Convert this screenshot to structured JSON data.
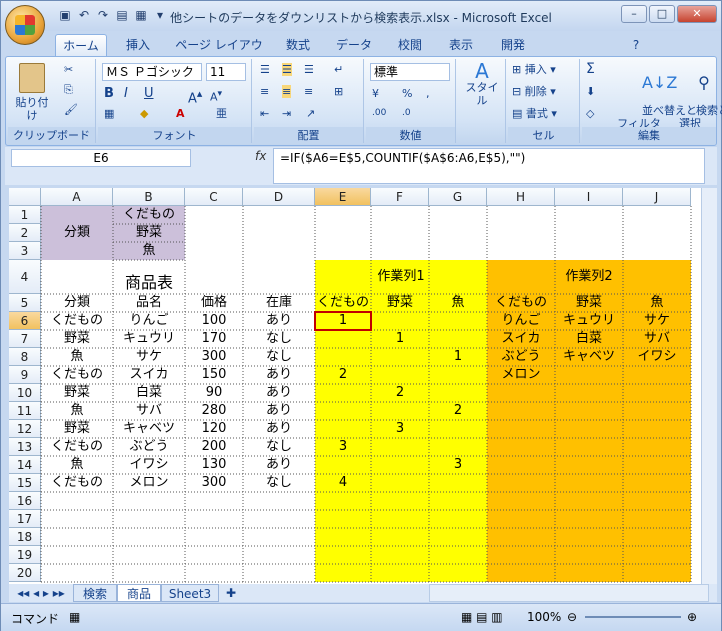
{
  "window": {
    "title": "他シートのデータをダウンリストから検索表示.xlsx - Microsoft Excel"
  },
  "ribbon_tabs": [
    "ホーム",
    "挿入",
    "ページ レイアウト",
    "数式",
    "データ",
    "校閲",
    "表示",
    "開発"
  ],
  "ribbon": {
    "paste": "貼り付け",
    "clipboard": "クリップボード",
    "font_name": "ＭＳ Ｐゴシック",
    "font_size": "11",
    "font_group": "フォント",
    "align_group": "配置",
    "number_format": "標準",
    "number_group": "数値",
    "style": "スタイル",
    "insert": "挿入",
    "delete": "削除",
    "format": "書式",
    "cell_group": "セル",
    "sort_filter": "並べ替えと\nフィルタ",
    "find_select": "検索と\n選択",
    "edit_group": "編集",
    "sigma": "Σ",
    "bold": "B",
    "italic": "I",
    "underline": "U"
  },
  "formula": {
    "name_box": "E6",
    "fx": "fx",
    "text": "=IF($A6=E$5,COUNTIF($A$6:A6,E$5),\"\")"
  },
  "columns": [
    "A",
    "B",
    "C",
    "D",
    "E",
    "F",
    "G",
    "H",
    "I",
    "J"
  ],
  "rows": [
    "1",
    "2",
    "3",
    "4",
    "5",
    "6",
    "7",
    "8",
    "9",
    "10",
    "11",
    "12",
    "13",
    "14",
    "15",
    "16",
    "17",
    "18",
    "19",
    "20"
  ],
  "cells": {
    "A1": "分類",
    "B1": "くだもの",
    "B2": "野菜",
    "B3": "魚",
    "B4": "商品表",
    "E4": "作業列1",
    "H4": "作業列2",
    "hdr": [
      "分類",
      "品名",
      "価格",
      "在庫",
      "くだもの",
      "野菜",
      "魚",
      "くだもの",
      "野菜",
      "魚"
    ],
    "data": [
      [
        "くだもの",
        "りんご",
        "100",
        "あり",
        "1",
        "",
        "",
        "りんご",
        "キュウリ",
        "サケ"
      ],
      [
        "野菜",
        "キュウリ",
        "170",
        "なし",
        "",
        "1",
        "",
        "スイカ",
        "白菜",
        "サバ"
      ],
      [
        "魚",
        "サケ",
        "300",
        "なし",
        "",
        "",
        "1",
        "ぶどう",
        "キャベツ",
        "イワシ"
      ],
      [
        "くだもの",
        "スイカ",
        "150",
        "あり",
        "2",
        "",
        "",
        "メロン",
        "",
        ""
      ],
      [
        "野菜",
        "白菜",
        "90",
        "あり",
        "",
        "2",
        "",
        "",
        "",
        ""
      ],
      [
        "魚",
        "サバ",
        "280",
        "あり",
        "",
        "",
        "2",
        "",
        "",
        ""
      ],
      [
        "野菜",
        "キャベツ",
        "120",
        "あり",
        "",
        "3",
        "",
        "",
        "",
        ""
      ],
      [
        "くだもの",
        "ぶどう",
        "200",
        "なし",
        "3",
        "",
        "",
        "",
        "",
        ""
      ],
      [
        "魚",
        "イワシ",
        "130",
        "あり",
        "",
        "",
        "3",
        "",
        "",
        ""
      ],
      [
        "くだもの",
        "メロン",
        "300",
        "なし",
        "4",
        "",
        "",
        "",
        "",
        ""
      ]
    ]
  },
  "sheet_tabs": [
    "検索",
    "商品",
    "Sheet3"
  ],
  "status": {
    "mode": "コマンド",
    "zoom": "100%"
  },
  "colors": {
    "purple": "#ccc0da",
    "yellow": "#ffff00",
    "orange": "#ffc000",
    "selection": "#c00000"
  }
}
